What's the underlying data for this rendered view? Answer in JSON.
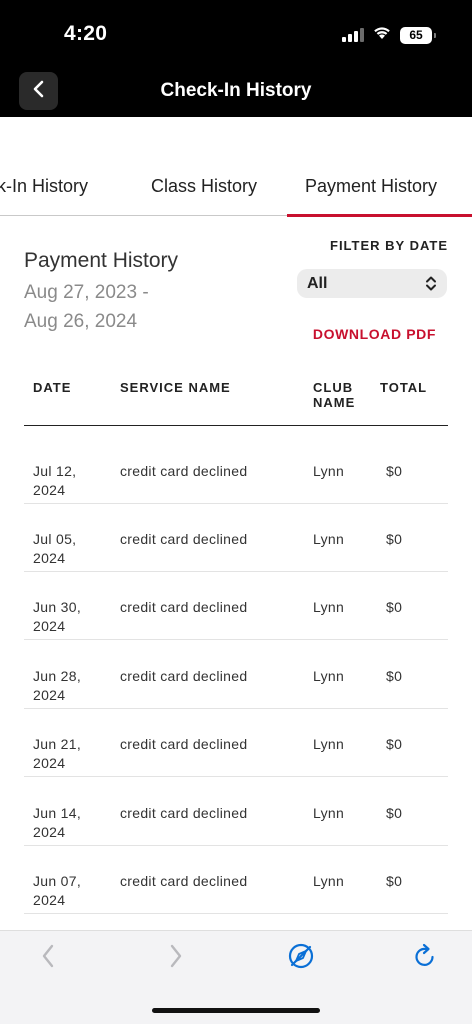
{
  "status_bar": {
    "time": "4:20",
    "battery": "65"
  },
  "header": {
    "title": "Check-In History"
  },
  "tabs": [
    {
      "label": "ck-In History"
    },
    {
      "label": "Class History"
    },
    {
      "label": "Payment History",
      "active": true
    }
  ],
  "summary": {
    "title": "Payment History",
    "range_start": "Aug 27, 2023 -",
    "range_end": "Aug 26, 2024"
  },
  "filter": {
    "label": "FILTER BY DATE",
    "selected": "All"
  },
  "download_label": "DOWNLOAD PDF",
  "table": {
    "headers": {
      "date": "DATE",
      "service": "SERVICE NAME",
      "club": "CLUB NAME",
      "total": "TOTAL"
    },
    "rows": [
      {
        "date": "Jul 12, 2024",
        "service": "credit card declined",
        "club": "Lynn",
        "total": "$0"
      },
      {
        "date": "Jul 05, 2024",
        "service": "credit card declined",
        "club": "Lynn",
        "total": "$0"
      },
      {
        "date": "Jun 30, 2024",
        "service": "credit card declined",
        "club": "Lynn",
        "total": "$0"
      },
      {
        "date": "Jun 28, 2024",
        "service": "credit card declined",
        "club": "Lynn",
        "total": "$0"
      },
      {
        "date": "Jun 21, 2024",
        "service": "credit card declined",
        "club": "Lynn",
        "total": "$0"
      },
      {
        "date": "Jun 14, 2024",
        "service": "credit card declined",
        "club": "Lynn",
        "total": "$0"
      },
      {
        "date": "Jun 07, 2024",
        "service": "credit card declined",
        "club": "Lynn",
        "total": "$0"
      }
    ]
  },
  "colors": {
    "accent": "#c8102e",
    "header_bg": "#000000",
    "safari_blue": "#0a6fd6"
  },
  "icons": [
    "chevron-left-icon",
    "chevron-up-down-icon",
    "compass-icon",
    "reload-icon",
    "wifi-icon",
    "signal-icon",
    "battery-icon"
  ]
}
